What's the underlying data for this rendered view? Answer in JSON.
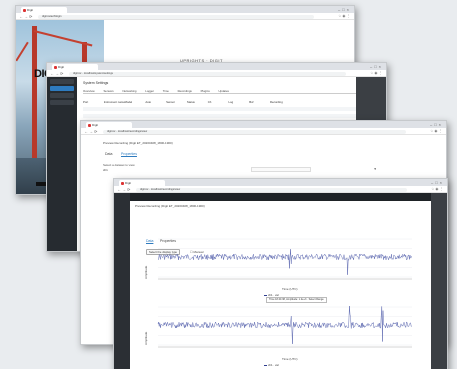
{
  "window1": {
    "tab_title": "Digit",
    "url": "digit.io/auth/login",
    "page_title": "UPRIGHTS · DIGIT",
    "logo": "DIGIT",
    "button": ""
  },
  "window2": {
    "tab_title": "Digit",
    "url": "digit.io/... localhost/system/settings",
    "title": "System Settings",
    "tabs": [
      "Overview",
      "Sensors",
      "Networking",
      "Logger",
      "Time",
      "Recordings",
      "Plugins",
      "Updates"
    ],
    "table_headers": [
      "Port",
      "Instrument name",
      "Model",
      "Auto",
      "Sensor",
      "Status",
      "Ch",
      "Log",
      "Buf",
      "Recording"
    ]
  },
  "window3": {
    "tab_title": "Digit",
    "url": "digit.io/... localhost/recordings/view",
    "title": "Preview Recording (Digit ET_20200408_1800-1900)",
    "tab_data": "Data",
    "tab_props": "Properties",
    "field_label": "Select a dataset to view",
    "field_value": "ch1"
  },
  "window4": {
    "tab_title": "Digit",
    "url": "digit.io/... localhost/recordings/view",
    "title": "Preview Recording (Digit ET_20200408_1800-1900)",
    "tab_data": "Data",
    "tab_props": "Properties",
    "button_label": "Select the display type",
    "checkbox_label": "Manual",
    "tooltip_text": "Time 18:44:38, Amplitude: 1.2e+3 · Select Range",
    "legend_ch": "ch1 · val",
    "plots": [
      {
        "x_title": "Time (UTC)",
        "y_title": "Amplitude"
      },
      {
        "x_title": "Time (UTC)",
        "y_title": "Amplitude"
      }
    ]
  },
  "colors": {
    "accent": "#2e7bbf",
    "trace": "#3a47a0",
    "dark": "#262b30"
  }
}
